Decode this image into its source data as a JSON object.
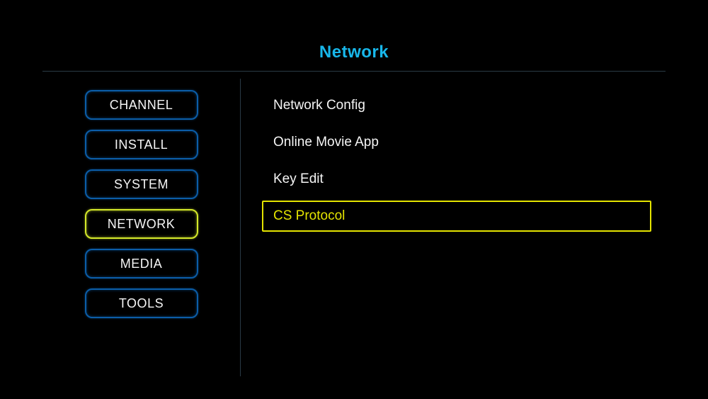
{
  "header": {
    "title": "Network"
  },
  "sidebar": {
    "items": [
      {
        "label": "CHANNEL",
        "active": false
      },
      {
        "label": "INSTALL",
        "active": false
      },
      {
        "label": "SYSTEM",
        "active": false
      },
      {
        "label": "NETWORK",
        "active": true
      },
      {
        "label": "MEDIA",
        "active": false
      },
      {
        "label": "TOOLS",
        "active": false
      }
    ]
  },
  "content": {
    "items": [
      {
        "label": "Network Config",
        "selected": false
      },
      {
        "label": "Online Movie App",
        "selected": false
      },
      {
        "label": "Key Edit",
        "selected": false
      },
      {
        "label": "CS Protocol",
        "selected": true
      }
    ]
  }
}
